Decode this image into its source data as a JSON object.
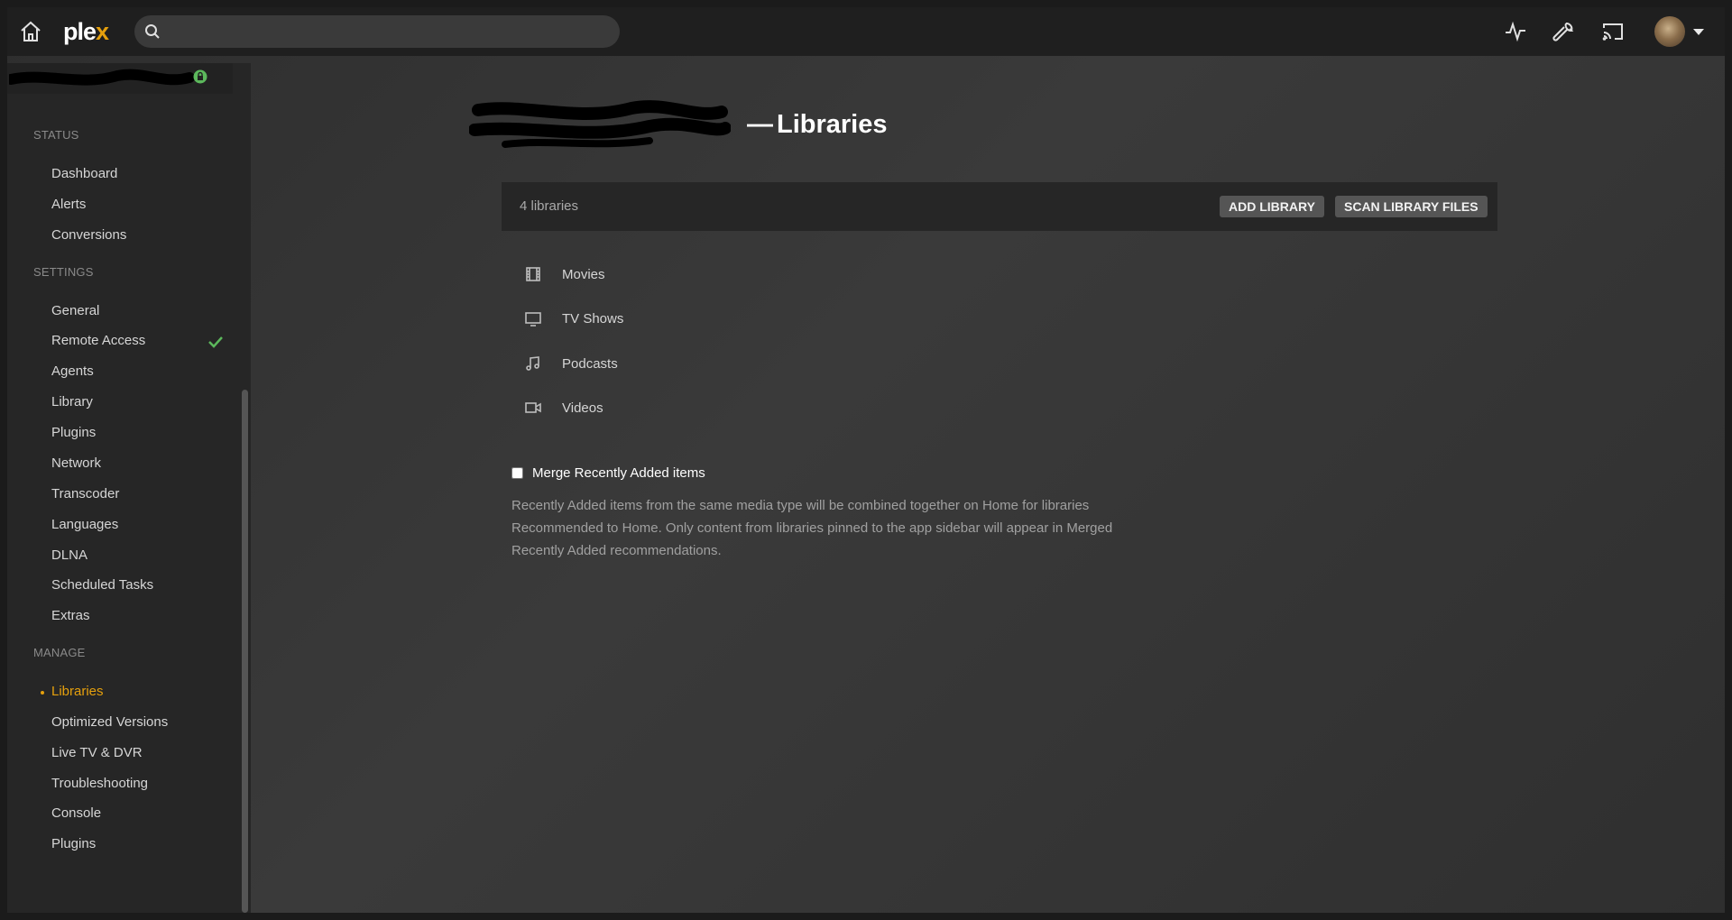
{
  "app": {
    "logo_main": "ple",
    "logo_accent": "x",
    "accent_color": "#e5a00d"
  },
  "search": {
    "placeholder": "",
    "value": ""
  },
  "toolbar": {
    "icons": [
      "activity-icon",
      "settings-wrench-icon",
      "cast-icon"
    ],
    "avatar": "user-avatar"
  },
  "sidebar": {
    "sections": [
      {
        "title": "STATUS",
        "items": [
          "Dashboard",
          "Alerts",
          "Conversions"
        ]
      },
      {
        "title": "SETTINGS",
        "items": [
          "General",
          "Remote Access",
          "Agents",
          "Library",
          "Plugins",
          "Network",
          "Transcoder",
          "Languages",
          "DLNA",
          "Scheduled Tasks",
          "Extras"
        ]
      },
      {
        "title": "MANAGE",
        "items": [
          "Libraries",
          "Optimized Versions",
          "Live TV & DVR",
          "Troubleshooting",
          "Console",
          "Plugins"
        ]
      }
    ],
    "active_item": "Libraries",
    "status_check_item": "Remote Access"
  },
  "page": {
    "title": "Libraries",
    "dash": "—"
  },
  "libraries_panel": {
    "count_label": "4 libraries",
    "add_button": "ADD LIBRARY",
    "scan_button": "SCAN LIBRARY FILES",
    "items": [
      {
        "name": "Movies",
        "icon": "film-icon"
      },
      {
        "name": "TV Shows",
        "icon": "tv-icon"
      },
      {
        "name": "Podcasts",
        "icon": "music-note-icon"
      },
      {
        "name": "Videos",
        "icon": "video-camera-icon"
      }
    ]
  },
  "merge": {
    "label": "Merge Recently Added items",
    "checked": false,
    "description": "Recently Added items from the same media type will be combined together on Home for libraries Recommended to Home. Only content from libraries pinned to the app sidebar will appear in Merged Recently Added recommendations."
  }
}
